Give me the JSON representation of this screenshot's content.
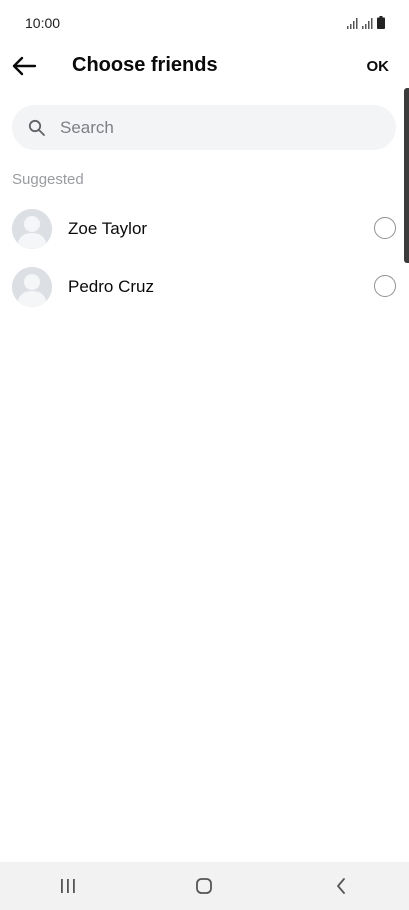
{
  "status_bar": {
    "time": "10:00"
  },
  "header": {
    "title": "Choose friends",
    "ok_label": "OK"
  },
  "search": {
    "placeholder": "Search",
    "value": ""
  },
  "section": {
    "label": "Suggested"
  },
  "friends": [
    {
      "name": "Zoe Taylor",
      "selected": false
    },
    {
      "name": "Pedro Cruz",
      "selected": false
    }
  ],
  "icons": {
    "back": "arrow-left-icon",
    "search": "search-icon",
    "avatar": "default-avatar-icon",
    "nav_recent": "recent-apps-icon",
    "nav_home": "home-icon",
    "nav_back": "back-chevron-icon"
  },
  "colors": {
    "text": "#0a0a0a",
    "muted": "#9a9ca0",
    "search_bg": "#f3f4f6",
    "nav_bg": "#f2f2f2"
  }
}
